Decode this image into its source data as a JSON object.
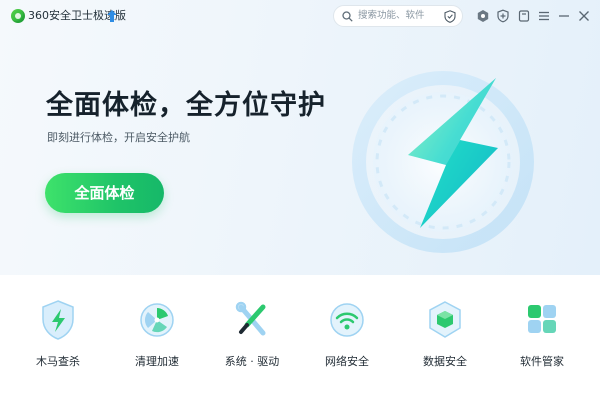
{
  "titlebar": {
    "app_title": "360安全卫士极速版",
    "search_placeholder": "搜索功能、软件",
    "icons": [
      "logo-icon",
      "update-arrow-icon",
      "search-icon",
      "shield-icon",
      "security-icon",
      "plugin-icon",
      "menu-icon",
      "minimize-icon",
      "close-icon"
    ]
  },
  "hero": {
    "headline": "全面体检，全方位守护",
    "subline": "即刻进行体检，开启安全护航",
    "cta_label": "全面体检",
    "graphic": "lightning-bolt-ring"
  },
  "features": [
    {
      "label": "木马查杀",
      "icon": "shield-lightning-icon"
    },
    {
      "label": "清理加速",
      "icon": "fan-cleaner-icon"
    },
    {
      "label": "系统 · 驱动",
      "icon": "wrench-screwdriver-icon"
    },
    {
      "label": "网络安全",
      "icon": "wifi-icon"
    },
    {
      "label": "数据安全",
      "icon": "data-cube-icon"
    },
    {
      "label": "软件管家",
      "icon": "app-blocks-icon"
    }
  ],
  "colors": {
    "accent_green": "#1fc468",
    "hero_bg": "#eef5fb",
    "bolt_cyan": "#1fd6c8"
  }
}
